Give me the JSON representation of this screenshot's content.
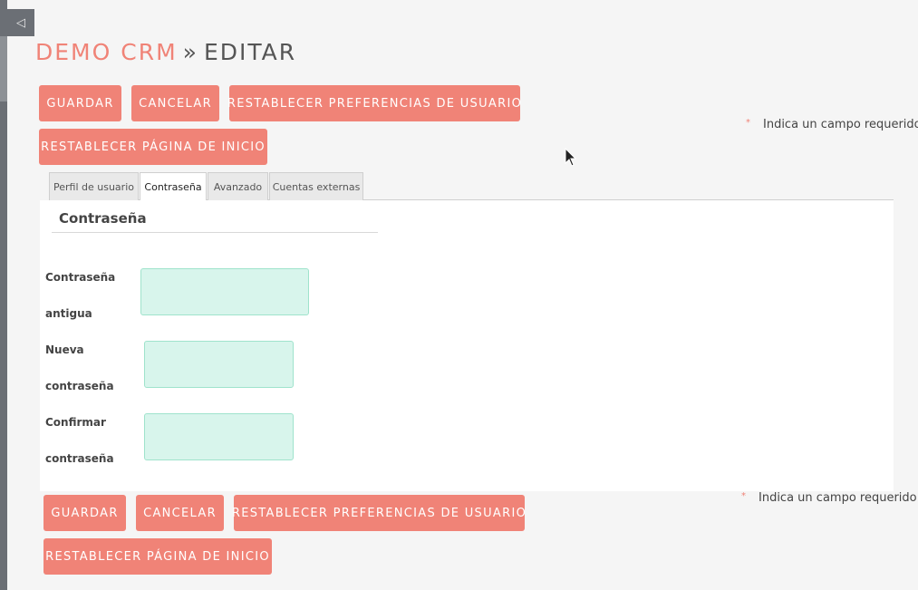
{
  "header": {
    "collapse_glyph": "◁",
    "module": "DEMO CRM",
    "separator": "»",
    "action": "EDITAR"
  },
  "toolbar_top": {
    "save": "GUARDAR",
    "cancel": "CANCELAR",
    "reset_prefs": "RESTABLECER PREFERENCIAS DE USUARIO",
    "reset_home": "RESTABLECER PÁGINA DE INICIO"
  },
  "toolbar_bottom": {
    "save": "GUARDAR",
    "cancel": "CANCELAR",
    "reset_prefs": "RESTABLECER PREFERENCIAS DE USUARIO",
    "reset_home": "RESTABLECER PÁGINA DE INICIO"
  },
  "required_note": {
    "star": "*",
    "text": "Indica un campo requerido"
  },
  "tabs": [
    {
      "label": "Perfil de usuario",
      "active": false
    },
    {
      "label": "Contraseña",
      "active": true
    },
    {
      "label": "Avanzado",
      "active": false
    },
    {
      "label": "Cuentas externas",
      "active": false
    }
  ],
  "panel": {
    "title": "Contraseña",
    "fields": [
      {
        "line1": "Contraseña",
        "line2": "antigua",
        "value": ""
      },
      {
        "line1": "Nueva",
        "line2": "contraseña",
        "value": ""
      },
      {
        "line1": "Confirmar",
        "line2": "contraseña",
        "value": ""
      }
    ]
  },
  "colors": {
    "accent": "#f08377",
    "input_bg": "#d8f5ec",
    "rail": "#6b6f75"
  }
}
